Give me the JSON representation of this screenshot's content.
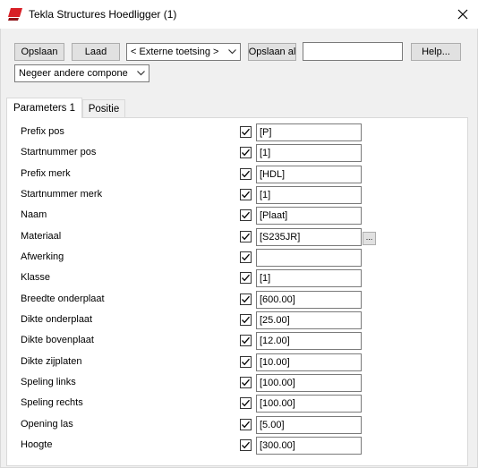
{
  "window": {
    "title": "Tekla Structures  Hoedligger (1)",
    "icon": "tekla-logo-icon",
    "close_icon": "close-icon"
  },
  "toolbar": {
    "save_label": "Opslaan",
    "load_label": "Laad",
    "preset_selected": "< Externe toetsing >",
    "save_as_label": "Opslaan al",
    "save_as_name": "",
    "help_label": "Help...",
    "filter_selected": "Negeer andere compone"
  },
  "tabs": [
    {
      "label": "Parameters 1",
      "active": true
    },
    {
      "label": "Positie",
      "active": false
    }
  ],
  "params": [
    {
      "label": "Prefix pos",
      "checked": true,
      "value": "[P]"
    },
    {
      "label": "Startnummer pos",
      "checked": true,
      "value": "[1]"
    },
    {
      "label": "Prefix merk",
      "checked": true,
      "value": "[HDL]"
    },
    {
      "label": "Startnummer merk",
      "checked": true,
      "value": "[1]"
    },
    {
      "label": "Naam",
      "checked": true,
      "value": "[Plaat]"
    },
    {
      "label": "Materiaal",
      "checked": true,
      "value": "[S235JR]",
      "browse": "..."
    },
    {
      "label": "Afwerking",
      "checked": true,
      "value": ""
    },
    {
      "label": "Klasse",
      "checked": true,
      "value": "[1]"
    },
    {
      "label": "Breedte onderplaat",
      "checked": true,
      "value": "[600.00]"
    },
    {
      "label": "Dikte onderplaat",
      "checked": true,
      "value": "[25.00]"
    },
    {
      "label": "Dikte bovenplaat",
      "checked": true,
      "value": "[12.00]"
    },
    {
      "label": "Dikte zijplaten",
      "checked": true,
      "value": "[10.00]"
    },
    {
      "label": "Speling links",
      "checked": true,
      "value": "[100.00]"
    },
    {
      "label": "Speling rechts",
      "checked": true,
      "value": "[100.00]"
    },
    {
      "label": "Opening las",
      "checked": true,
      "value": "[5.00]"
    },
    {
      "label": "Hoogte",
      "checked": true,
      "value": "[300.00]"
    }
  ],
  "colors": {
    "logo_red": "#d81f26",
    "panel_bg": "#ffffff",
    "dialog_bg": "#f0f0f0"
  }
}
